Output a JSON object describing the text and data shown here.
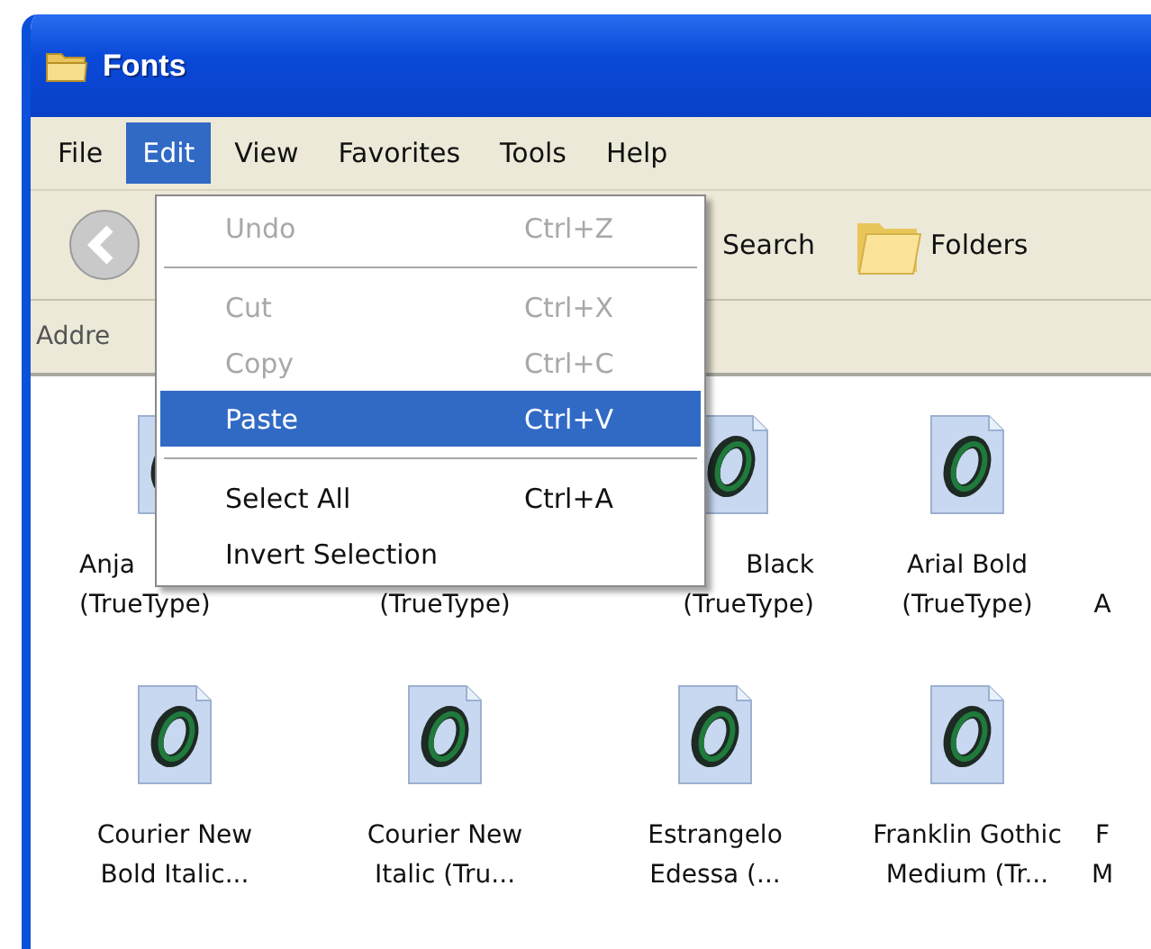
{
  "window": {
    "title": "Fonts"
  },
  "menubar": [
    {
      "label": "File",
      "selected": false
    },
    {
      "label": "Edit",
      "selected": true
    },
    {
      "label": "View",
      "selected": false
    },
    {
      "label": "Favorites",
      "selected": false
    },
    {
      "label": "Tools",
      "selected": false
    },
    {
      "label": "Help",
      "selected": false
    }
  ],
  "toolbar": {
    "search": "Search",
    "folders": "Folders"
  },
  "address_bar": {
    "label": "Addre"
  },
  "edit_menu": [
    {
      "kind": "item",
      "label": "Undo",
      "shortcut": "Ctrl+Z",
      "disabled": true,
      "selected": false
    },
    {
      "kind": "separator"
    },
    {
      "kind": "item",
      "label": "Cut",
      "shortcut": "Ctrl+X",
      "disabled": true,
      "selected": false
    },
    {
      "kind": "item",
      "label": "Copy",
      "shortcut": "Ctrl+C",
      "disabled": true,
      "selected": false
    },
    {
      "kind": "item",
      "label": "Paste",
      "shortcut": "Ctrl+V",
      "disabled": false,
      "selected": true
    },
    {
      "kind": "separator"
    },
    {
      "kind": "item",
      "label": "Select All",
      "shortcut": "Ctrl+A",
      "disabled": false,
      "selected": false
    },
    {
      "kind": "item",
      "label": "Invert Selection",
      "disabled": false,
      "selected": false
    }
  ],
  "files": [
    [
      {
        "lines": [
          "Anja",
          "(TrueType)"
        ],
        "icon": true
      },
      {
        "lines": [
          "(TrueType)"
        ],
        "icon": false
      },
      {
        "lines": [
          "Black",
          "(TrueType)"
        ],
        "icon": true
      },
      {
        "lines": [
          "Arial Bold",
          "(TrueType)"
        ],
        "icon": true
      },
      {
        "lines": [
          "A"
        ],
        "icon": false
      }
    ],
    [
      {
        "lines": [
          "Courier New",
          "Bold Italic..."
        ],
        "icon": true
      },
      {
        "lines": [
          "Courier New",
          "Italic (Tru..."
        ],
        "icon": true
      },
      {
        "lines": [
          "Estrangelo",
          "Edessa (..."
        ],
        "icon": true
      },
      {
        "lines": [
          "Franklin Gothic",
          "Medium (Tr..."
        ],
        "icon": true
      },
      {
        "lines": [
          "F",
          "M"
        ],
        "icon": false
      }
    ]
  ]
}
